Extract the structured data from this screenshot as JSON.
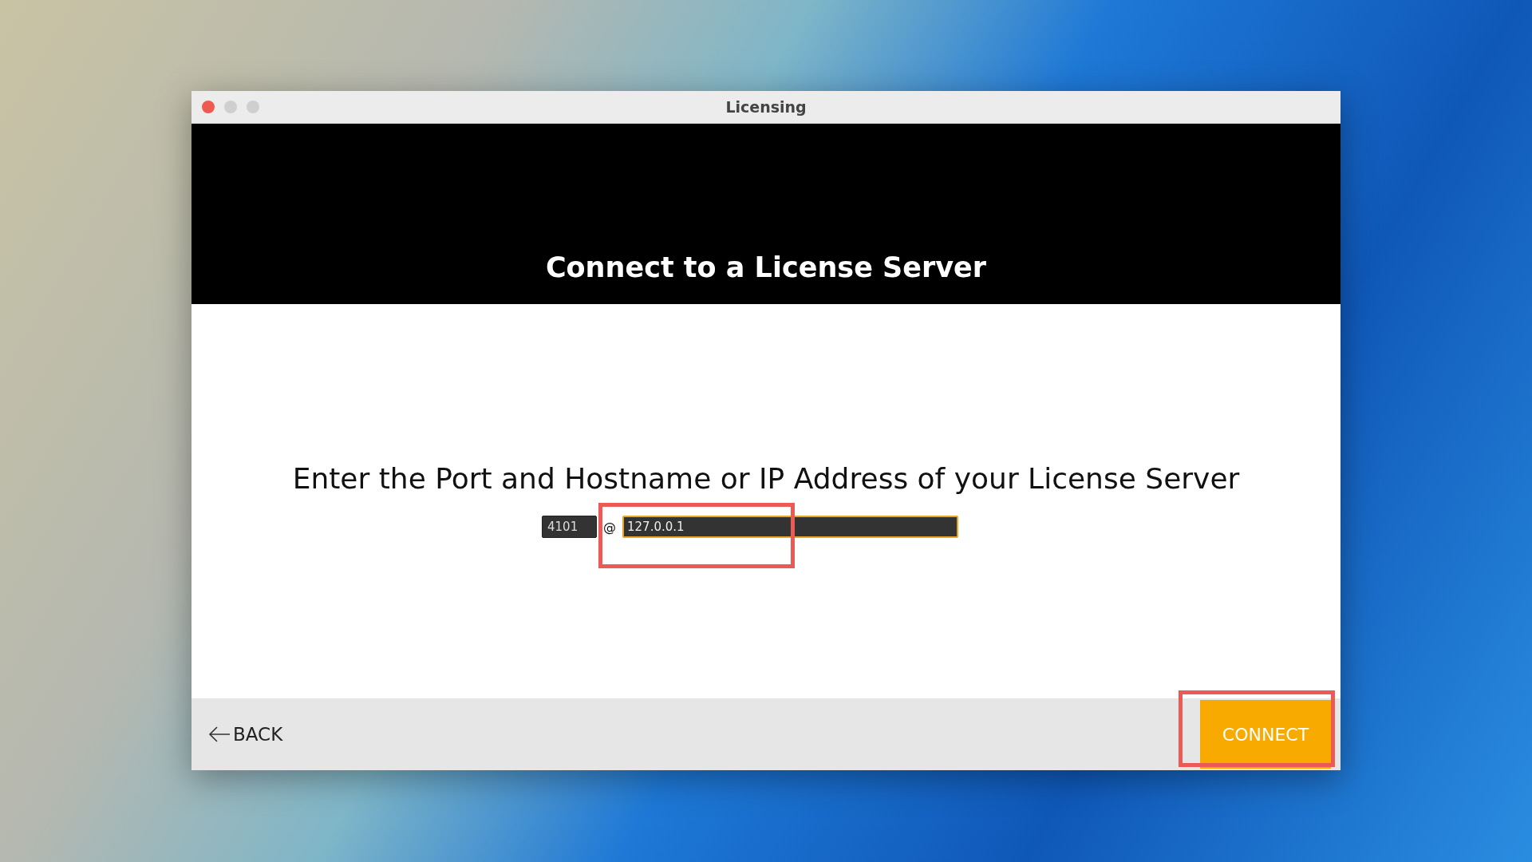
{
  "window": {
    "title": "Licensing"
  },
  "header": {
    "title": "Connect to a License Server"
  },
  "prompt": "Enter the Port and Hostname or IP Address of your License Server",
  "port_field": {
    "value": "4101"
  },
  "separator": "@",
  "host_field": {
    "value": "127.0.0.1",
    "focused": true
  },
  "footer": {
    "back_button": "BACK",
    "connect_button": "CONNECT"
  }
}
